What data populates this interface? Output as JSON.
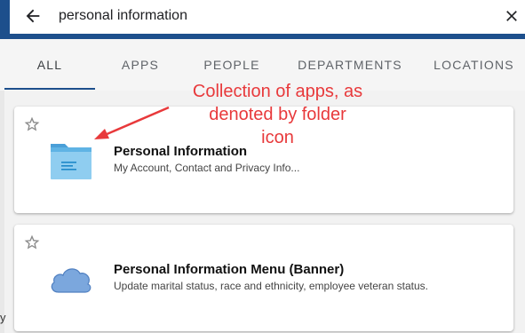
{
  "search": {
    "query": "personal information",
    "back_icon": "arrow-left-icon",
    "clear_icon": "close-icon",
    "header_color": "#1d4f8c"
  },
  "tabs": [
    {
      "label": "ALL",
      "active": true
    },
    {
      "label": "APPS",
      "active": false
    },
    {
      "label": "PEOPLE",
      "active": false
    },
    {
      "label": "DEPARTMENTS",
      "active": false
    },
    {
      "label": "LOCATIONS",
      "active": false
    }
  ],
  "results": [
    {
      "title": "Personal Information",
      "description": "My Account, Contact and Privacy Info...",
      "icon": "folder-icon",
      "favorite_icon": "star-outline-icon"
    },
    {
      "title": "Personal Information Menu (Banner)",
      "description": "Update marital status, race and ethnicity, employee veteran status.",
      "icon": "cloud-icon",
      "favorite_icon": "star-outline-icon"
    }
  ],
  "annotation": {
    "text_lines": [
      "Collection of apps, as",
      "denoted by folder",
      "icon"
    ],
    "color": "#e8393b"
  },
  "edge_glyph": "y"
}
